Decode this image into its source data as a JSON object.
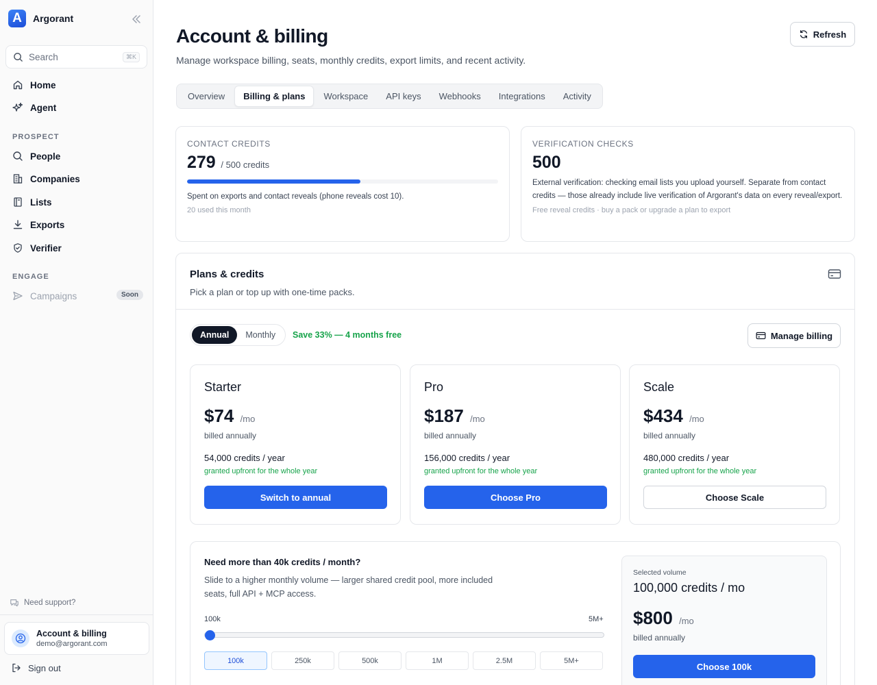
{
  "app": {
    "name": "Argorant",
    "logo_letter": "A"
  },
  "sidebar": {
    "search_placeholder": "Search",
    "search_shortcut": "⌘K",
    "primary": [
      {
        "label": "Home",
        "icon": "home-icon"
      },
      {
        "label": "Agent",
        "icon": "sparkles-icon"
      }
    ],
    "prospect_title": "PROSPECT",
    "prospect": [
      {
        "label": "People",
        "icon": "search-icon"
      },
      {
        "label": "Companies",
        "icon": "building-icon"
      },
      {
        "label": "Lists",
        "icon": "book-icon"
      },
      {
        "label": "Exports",
        "icon": "download-icon"
      },
      {
        "label": "Verifier",
        "icon": "shield-icon"
      }
    ],
    "engage_title": "ENGAGE",
    "engage": [
      {
        "label": "Campaigns",
        "icon": "send-icon",
        "badge": "Soon"
      }
    ],
    "support": "Need support?",
    "user": {
      "title": "Account & billing",
      "email": "demo@argorant.com"
    },
    "signout": "Sign out"
  },
  "header": {
    "title": "Account & billing",
    "subtitle": "Manage workspace billing, seats, monthly credits, export limits, and recent activity.",
    "refresh": "Refresh"
  },
  "tabs": [
    "Overview",
    "Billing & plans",
    "Workspace",
    "API keys",
    "Webhooks",
    "Integrations",
    "Activity"
  ],
  "active_tab": "Billing & plans",
  "stats": {
    "contact": {
      "label": "CONTACT CREDITS",
      "value": "279",
      "unit": "/ 500 credits",
      "progress_fraction": 0.558,
      "desc": "Spent on exports and contact reveals (phone reveals cost 10).",
      "note": "20 used this month"
    },
    "verify": {
      "label": "VERIFICATION CHECKS",
      "value": "500",
      "desc": "External verification: checking email lists you upload yourself. Separate from contact credits — those already include live verification of Argorant's data on every reveal/export.",
      "note": "Free reveal credits · buy a pack or upgrade a plan to export"
    }
  },
  "plans": {
    "title": "Plans & credits",
    "subtitle": "Pick a plan or top up with one-time packs.",
    "toggle": {
      "annual": "Annual",
      "monthly": "Monthly",
      "selected": "Annual"
    },
    "save_note": "Save 33% — 4 months free",
    "manage": "Manage billing",
    "items": [
      {
        "name": "Starter",
        "price": "$74",
        "per": "/mo",
        "billed": "billed annually",
        "credits": "54,000 credits / year",
        "granted": "granted upfront for the whole year",
        "button": "Switch to annual"
      },
      {
        "name": "Pro",
        "price": "$187",
        "per": "/mo",
        "billed": "billed annually",
        "credits": "156,000 credits / year",
        "granted": "granted upfront for the whole year",
        "button": "Choose Pro"
      },
      {
        "name": "Scale",
        "price": "$434",
        "per": "/mo",
        "billed": "billed annually",
        "credits": "480,000 credits / year",
        "granted": "granted upfront for the whole year",
        "button": "Choose Scale"
      }
    ]
  },
  "volume": {
    "title": "Need more than 40k credits / month?",
    "subtitle": "Slide to a higher monthly volume — larger shared credit pool, more included seats, full API + MCP access.",
    "min": "100k",
    "max": "5M+",
    "slider_fraction": 0,
    "options": [
      "100k",
      "250k",
      "500k",
      "1M",
      "2.5M",
      "5M+"
    ],
    "selected_option": "100k",
    "selected": {
      "label": "Selected volume",
      "credits": "100,000 credits / mo",
      "price": "$800",
      "per": "/mo",
      "billed": "billed annually",
      "button": "Choose 100k"
    }
  },
  "colors": {
    "accent": "#2563eb",
    "success": "#16a34a",
    "dark": "#111827"
  }
}
